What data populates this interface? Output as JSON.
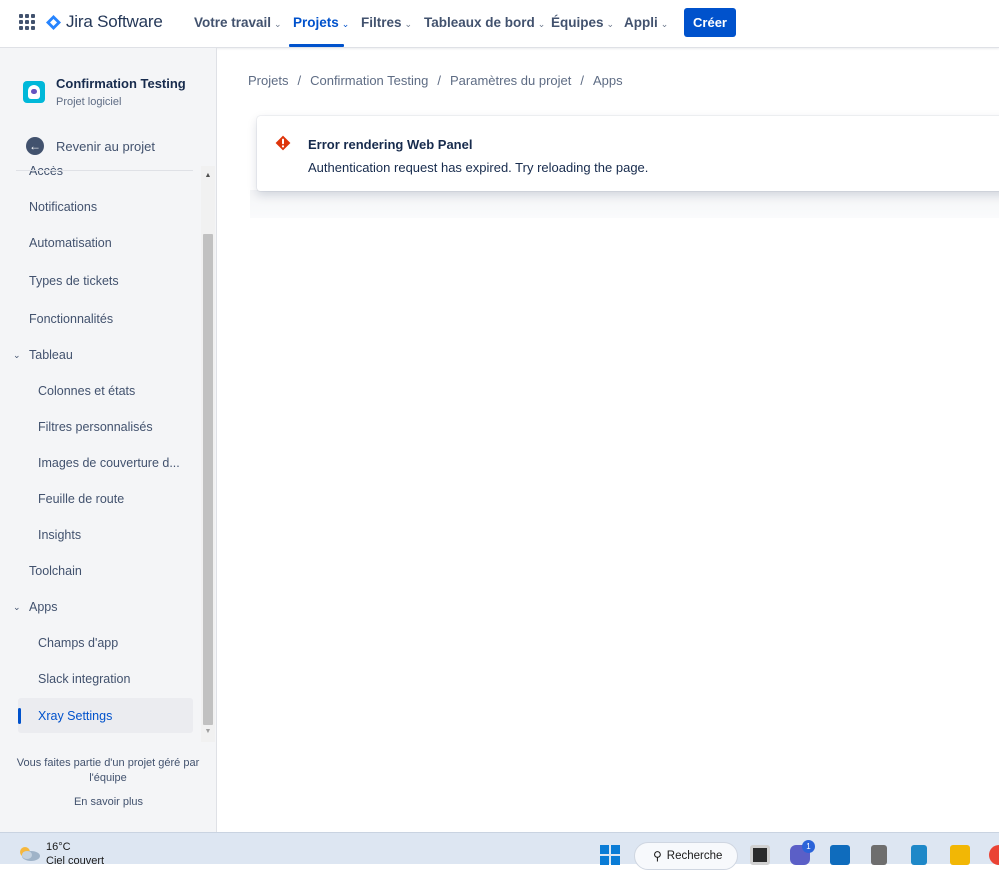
{
  "topnav": {
    "product_name": "Jira Software",
    "items": [
      {
        "label": "Votre travail"
      },
      {
        "label": "Projets"
      },
      {
        "label": "Filtres"
      },
      {
        "label": "Tableaux de bord"
      },
      {
        "label": "Équipes"
      },
      {
        "label": "Appli"
      }
    ],
    "active_item": "Projets",
    "create_label": "Créer"
  },
  "sidebar": {
    "project_name": "Confirmation Testing",
    "project_type": "Projet logiciel",
    "back_label": "Revenir au projet",
    "items": [
      {
        "label": "Accès"
      },
      {
        "label": "Notifications"
      },
      {
        "label": "Automatisation"
      },
      {
        "label": "Types de tickets"
      },
      {
        "label": "Fonctionnalités"
      },
      {
        "label": "Tableau"
      },
      {
        "label": "Colonnes et états"
      },
      {
        "label": "Filtres personnalisés"
      },
      {
        "label": "Images de couverture d..."
      },
      {
        "label": "Feuille de route"
      },
      {
        "label": "Insights"
      },
      {
        "label": "Toolchain"
      },
      {
        "label": "Apps"
      },
      {
        "label": "Champs d'app"
      },
      {
        "label": "Slack integration"
      },
      {
        "label": "Xray Settings"
      }
    ],
    "selected_item": "Xray Settings",
    "footer_note": "Vous faites partie d'un projet géré par l'équipe",
    "footer_link": "En savoir plus"
  },
  "breadcrumb": [
    "Projets",
    "Confirmation Testing",
    "Paramètres du projet",
    "Apps"
  ],
  "error_panel": {
    "title": "Error rendering Web Panel",
    "message": "Authentication request has expired. Try reloading the page."
  },
  "taskbar": {
    "temperature": "16°C",
    "weather": "Ciel couvert",
    "search_label": "Recherche",
    "teams_badge": "1"
  },
  "colors": {
    "accent": "#0052cc",
    "error": "#de350b",
    "sidebar_bg": "#f4f5f7"
  }
}
